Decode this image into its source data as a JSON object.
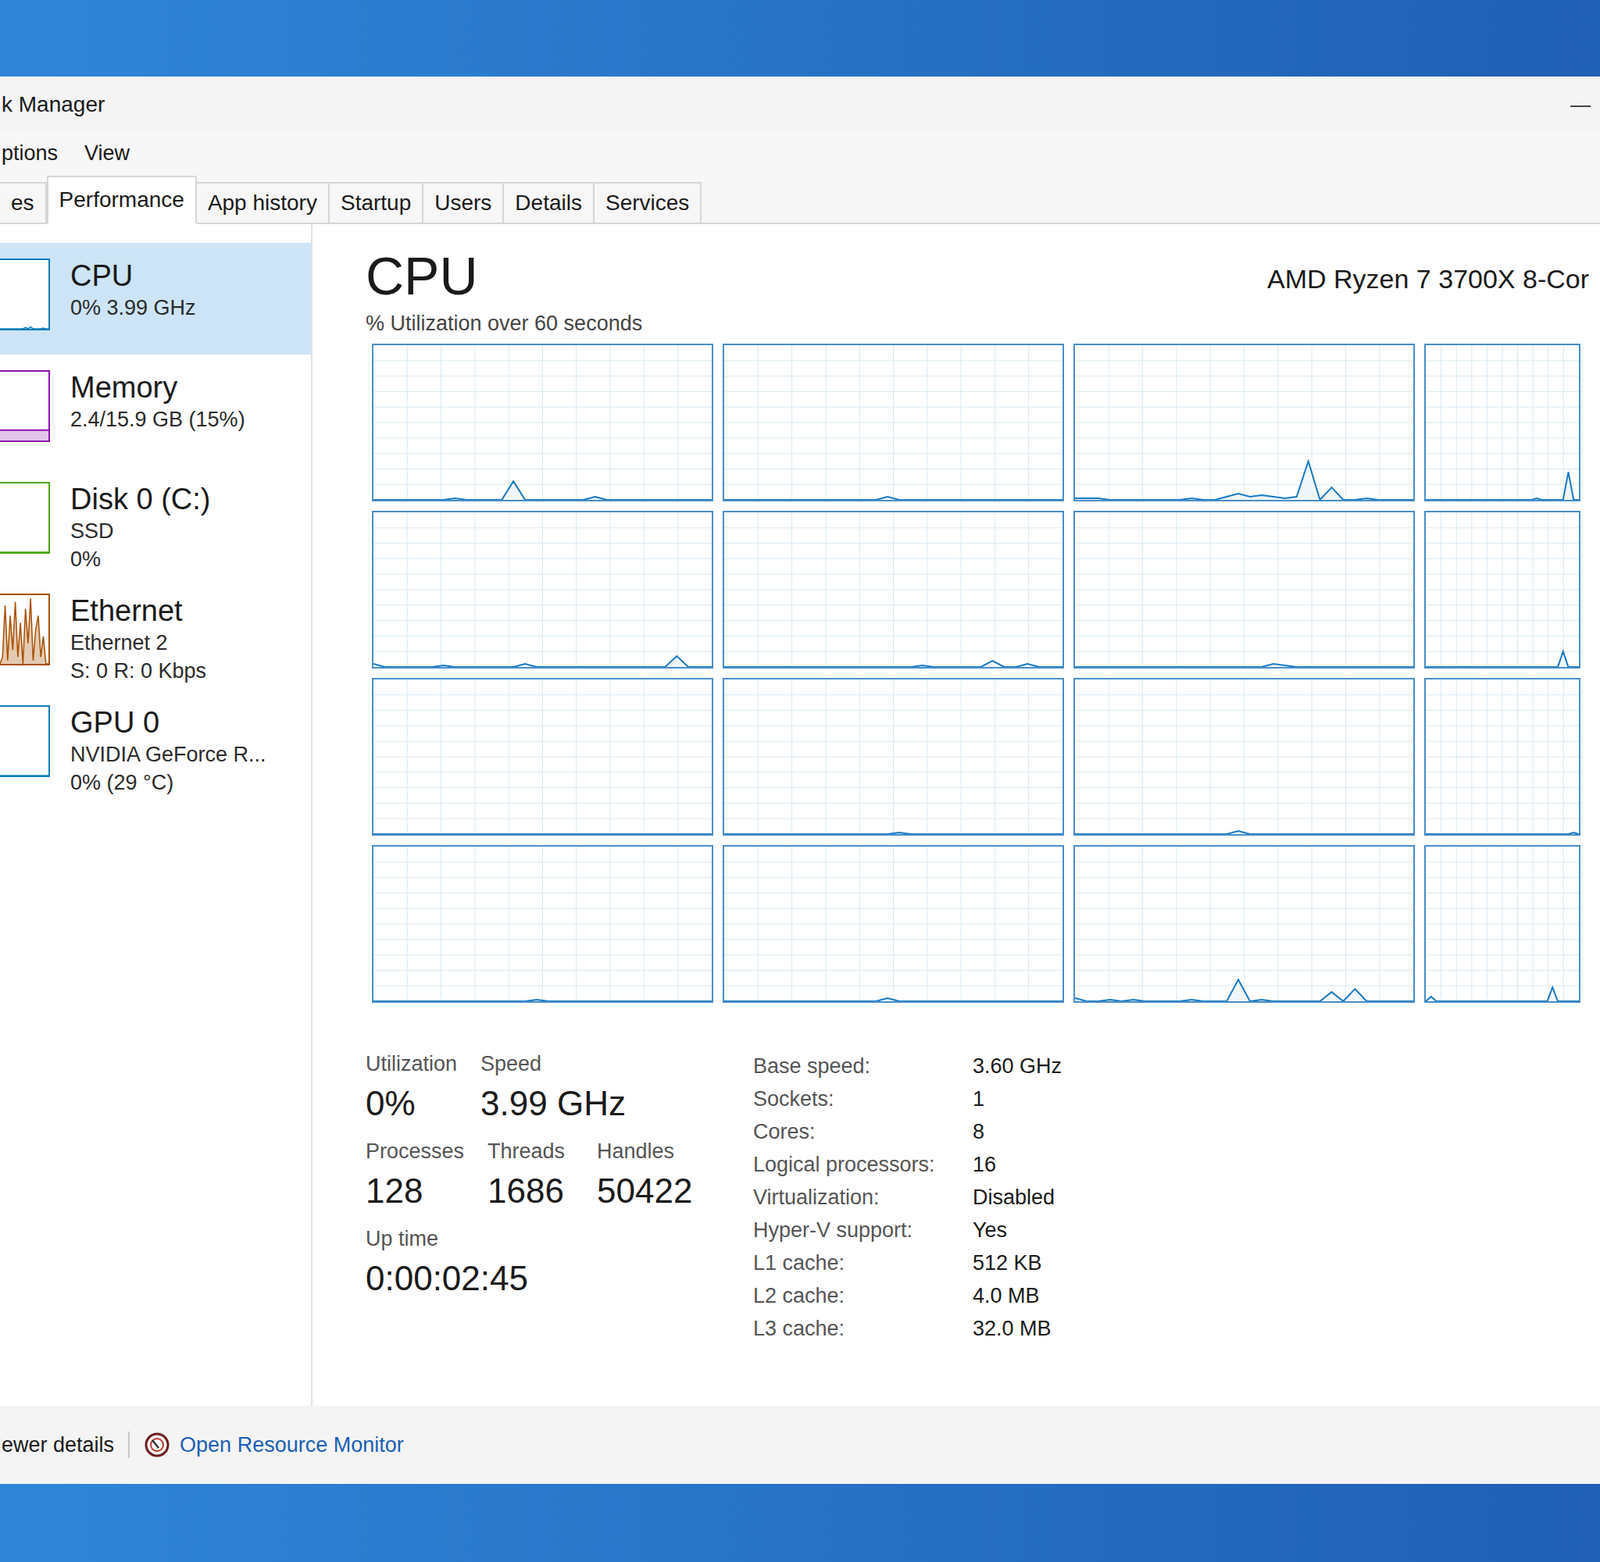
{
  "window": {
    "title": "k Manager",
    "minimize": "—"
  },
  "menu": [
    "ptions",
    "View"
  ],
  "tabs": [
    {
      "label": "es",
      "selected": false
    },
    {
      "label": "Performance",
      "selected": true
    },
    {
      "label": "App history",
      "selected": false
    },
    {
      "label": "Startup",
      "selected": false
    },
    {
      "label": "Users",
      "selected": false
    },
    {
      "label": "Details",
      "selected": false
    },
    {
      "label": "Services",
      "selected": false
    }
  ],
  "sidebar": {
    "items": [
      {
        "name": "CPU",
        "lines": [
          "0% 3.99 GHz"
        ],
        "selected": true,
        "kind": "line",
        "color": "#117dbb",
        "values": [
          0,
          0,
          0,
          0,
          0,
          0,
          0,
          0,
          0,
          0,
          2,
          0,
          3,
          0,
          0,
          0,
          0,
          1,
          0,
          0
        ]
      },
      {
        "name": "Memory",
        "lines": [
          "2.4/15.9 GB (15%)"
        ],
        "selected": false,
        "kind": "fill",
        "color": "#8b12ae",
        "level": 0.15
      },
      {
        "name": "Disk 0 (C:)",
        "lines": [
          "SSD",
          "0%"
        ],
        "selected": false,
        "kind": "line",
        "color": "#4da60c",
        "values": [
          0,
          0,
          0,
          0,
          0,
          0,
          0,
          0,
          0,
          0,
          0,
          0,
          0,
          0,
          0,
          0,
          0,
          0,
          0,
          0
        ]
      },
      {
        "name": "Ethernet",
        "lines": [
          "Ethernet 2",
          "S: 0 R: 0 Kbps"
        ],
        "selected": false,
        "kind": "line",
        "color": "#a74f01",
        "values": [
          0,
          10,
          85,
          5,
          70,
          20,
          90,
          10,
          60,
          0,
          80,
          30,
          95,
          5,
          50,
          70,
          10,
          40,
          0,
          0
        ]
      },
      {
        "name": "GPU 0",
        "lines": [
          "NVIDIA GeForce R...",
          "0% (29 °C)"
        ],
        "selected": false,
        "kind": "line",
        "color": "#117dbb",
        "values": [
          0,
          0,
          0,
          0,
          0,
          0,
          0,
          0,
          0,
          0,
          0,
          0,
          0,
          0,
          0,
          0,
          0,
          0,
          0,
          0
        ]
      }
    ]
  },
  "main": {
    "title": "CPU",
    "model": "AMD Ryzen 7 3700X 8-Cor",
    "chart_title": "% Utilization over 60 seconds",
    "graphs": [
      [
        0,
        0,
        0,
        0,
        0,
        0,
        0,
        1,
        0,
        0,
        0,
        0,
        12,
        0,
        0,
        0,
        0,
        0,
        0,
        2,
        0,
        0,
        0,
        0,
        0,
        0,
        0,
        0,
        0,
        0
      ],
      [
        0,
        0,
        0,
        0,
        0,
        0,
        0,
        0,
        0,
        0,
        0,
        0,
        0,
        0,
        2,
        0,
        0,
        0,
        0,
        0,
        0,
        0,
        0,
        0,
        0,
        0,
        0,
        0,
        0,
        0
      ],
      [
        1,
        1,
        1,
        0,
        0,
        0,
        0,
        0,
        0,
        0,
        1,
        0,
        0,
        2,
        4,
        2,
        3,
        2,
        1,
        2,
        25,
        0,
        8,
        0,
        0,
        1,
        0,
        0,
        0,
        0
      ],
      [
        0,
        0,
        0,
        0,
        0,
        0,
        0,
        0,
        0,
        0,
        0,
        0,
        0,
        0,
        0,
        0,
        0,
        0,
        0,
        0,
        0,
        1,
        0,
        0,
        0,
        0,
        0,
        18,
        0,
        0
      ],
      [
        2,
        0,
        0,
        0,
        0,
        0,
        1,
        0,
        0,
        0,
        0,
        0,
        0,
        2,
        0,
        0,
        0,
        0,
        0,
        0,
        0,
        0,
        0,
        0,
        0,
        0,
        7,
        0,
        0,
        0
      ],
      [
        0,
        0,
        0,
        0,
        0,
        0,
        0,
        0,
        0,
        0,
        0,
        0,
        0,
        0,
        0,
        0,
        0,
        1,
        0,
        0,
        0,
        0,
        0,
        4,
        0,
        0,
        2,
        0,
        0,
        0
      ],
      [
        0,
        0,
        0,
        0,
        0,
        0,
        0,
        0,
        0,
        0,
        0,
        0,
        0,
        0,
        0,
        0,
        0,
        2,
        1,
        0,
        0,
        0,
        0,
        0,
        0,
        0,
        0,
        0,
        0,
        0
      ],
      [
        0,
        0,
        0,
        0,
        0,
        0,
        0,
        0,
        0,
        0,
        0,
        0,
        0,
        0,
        0,
        0,
        0,
        0,
        0,
        0,
        0,
        0,
        0,
        0,
        0,
        0,
        10,
        0,
        0,
        0
      ],
      [
        0,
        0,
        0,
        0,
        0,
        0,
        0,
        0,
        0,
        0,
        0,
        0,
        0,
        0,
        0,
        0,
        0,
        0,
        0,
        0,
        0,
        0,
        0,
        0,
        0,
        0,
        0,
        0,
        0,
        0
      ],
      [
        0,
        0,
        0,
        0,
        0,
        0,
        0,
        0,
        0,
        0,
        0,
        0,
        0,
        0,
        0,
        1,
        0,
        0,
        0,
        0,
        0,
        0,
        0,
        0,
        0,
        0,
        0,
        0,
        0,
        0
      ],
      [
        0,
        0,
        0,
        0,
        0,
        0,
        0,
        0,
        0,
        0,
        0,
        0,
        0,
        0,
        2,
        0,
        0,
        0,
        0,
        0,
        0,
        0,
        0,
        0,
        0,
        0,
        0,
        0,
        0,
        0
      ],
      [
        0,
        0,
        0,
        0,
        0,
        0,
        0,
        0,
        0,
        0,
        0,
        0,
        0,
        0,
        0,
        0,
        0,
        0,
        0,
        0,
        0,
        0,
        0,
        0,
        0,
        0,
        0,
        0,
        1,
        0
      ],
      [
        0,
        0,
        0,
        0,
        0,
        0,
        0,
        0,
        0,
        0,
        0,
        0,
        0,
        0,
        1,
        0,
        0,
        0,
        0,
        0,
        0,
        0,
        0,
        0,
        0,
        0,
        0,
        0,
        0,
        0
      ],
      [
        0,
        0,
        0,
        0,
        0,
        0,
        0,
        0,
        0,
        0,
        0,
        0,
        0,
        0,
        2,
        0,
        0,
        0,
        0,
        0,
        0,
        0,
        0,
        0,
        0,
        0,
        0,
        0,
        0,
        0
      ],
      [
        2,
        0,
        0,
        1,
        0,
        1,
        0,
        0,
        0,
        0,
        1,
        0,
        0,
        0,
        14,
        0,
        1,
        0,
        0,
        0,
        0,
        0,
        6,
        0,
        8,
        0,
        0,
        0,
        0,
        0
      ],
      [
        0,
        3,
        0,
        0,
        0,
        0,
        0,
        0,
        0,
        0,
        0,
        0,
        0,
        0,
        0,
        0,
        0,
        0,
        0,
        0,
        0,
        0,
        0,
        0,
        9,
        0,
        0,
        0,
        0,
        0
      ]
    ]
  },
  "stats": {
    "blocks": [
      [
        {
          "label": "Utilization",
          "value": "0%"
        },
        {
          "label": "Speed",
          "value": "3.99 GHz"
        }
      ],
      [
        {
          "label": "Processes",
          "value": "128"
        },
        {
          "label": "Threads",
          "value": "1686"
        },
        {
          "label": "Handles",
          "value": "50422"
        }
      ],
      [
        {
          "label": "Up time",
          "value": "0:00:02:45"
        }
      ]
    ],
    "info": [
      {
        "label": "Base speed:",
        "value": "3.60 GHz"
      },
      {
        "label": "Sockets:",
        "value": "1"
      },
      {
        "label": "Cores:",
        "value": "8"
      },
      {
        "label": "Logical processors:",
        "value": "16"
      },
      {
        "label": "Virtualization:",
        "value": "Disabled"
      },
      {
        "label": "Hyper-V support:",
        "value": "Yes"
      },
      {
        "label": "L1 cache:",
        "value": "512 KB"
      },
      {
        "label": "L2 cache:",
        "value": "4.0 MB"
      },
      {
        "label": "L3 cache:",
        "value": "32.0 MB"
      }
    ]
  },
  "footer": {
    "details": "ewer details",
    "link": "Open Resource Monitor"
  }
}
